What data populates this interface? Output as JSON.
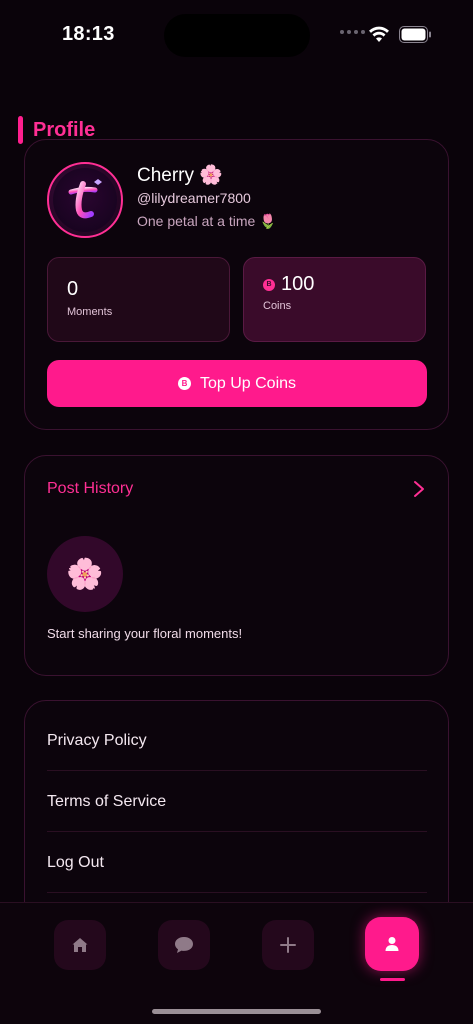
{
  "status_bar": {
    "time": "18:13"
  },
  "header": {
    "title": "Profile"
  },
  "profile": {
    "name": "Cherry 🌸",
    "handle": "@lilydreamer7800",
    "bio": "One petal at a time 🌷",
    "moments_value": "0",
    "moments_label": "Moments",
    "coins_value": "100",
    "coins_label": "Coins",
    "coin_symbol": "B",
    "topup_label": "Top Up Coins"
  },
  "history": {
    "title": "Post History",
    "flower": "🌸",
    "empty_text": "Start sharing your floral moments!"
  },
  "menu": {
    "privacy": "Privacy Policy",
    "terms": "Terms of Service",
    "logout": "Log Out"
  },
  "tabbar": {
    "active": "profile",
    "icons": [
      "home-icon",
      "chat-bubble-icon",
      "plus-icon",
      "user-icon"
    ]
  },
  "colors": {
    "accent": "#ff1a8c",
    "background": "#0a030a",
    "card_border": "#3a1230"
  }
}
